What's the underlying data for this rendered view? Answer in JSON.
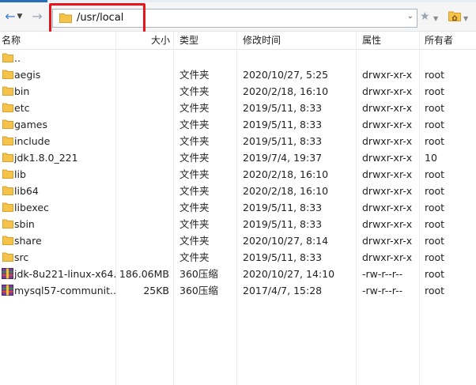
{
  "path": {
    "value": "/usr/local"
  },
  "columns": {
    "name": "名称",
    "size": "大小",
    "type": "类型",
    "modified": "修改时间",
    "attr": "属性",
    "owner": "所有者"
  },
  "rows": [
    {
      "name": "..",
      "size": "",
      "type": "",
      "modified": "",
      "attr": "",
      "owner": "",
      "icon": "folder-icon"
    },
    {
      "name": "aegis",
      "size": "",
      "type": "文件夹",
      "modified": "2020/10/27, 5:25",
      "attr": "drwxr-xr-x",
      "owner": "root",
      "icon": "folder-icon"
    },
    {
      "name": "bin",
      "size": "",
      "type": "文件夹",
      "modified": "2020/2/18, 16:10",
      "attr": "drwxr-xr-x",
      "owner": "root",
      "icon": "folder-icon"
    },
    {
      "name": "etc",
      "size": "",
      "type": "文件夹",
      "modified": "2019/5/11, 8:33",
      "attr": "drwxr-xr-x",
      "owner": "root",
      "icon": "folder-icon"
    },
    {
      "name": "games",
      "size": "",
      "type": "文件夹",
      "modified": "2019/5/11, 8:33",
      "attr": "drwxr-xr-x",
      "owner": "root",
      "icon": "folder-icon"
    },
    {
      "name": "include",
      "size": "",
      "type": "文件夹",
      "modified": "2019/5/11, 8:33",
      "attr": "drwxr-xr-x",
      "owner": "root",
      "icon": "folder-icon"
    },
    {
      "name": "jdk1.8.0_221",
      "size": "",
      "type": "文件夹",
      "modified": "2019/7/4, 19:37",
      "attr": "drwxr-xr-x",
      "owner": "10",
      "icon": "folder-icon"
    },
    {
      "name": "lib",
      "size": "",
      "type": "文件夹",
      "modified": "2020/2/18, 16:10",
      "attr": "drwxr-xr-x",
      "owner": "root",
      "icon": "folder-icon"
    },
    {
      "name": "lib64",
      "size": "",
      "type": "文件夹",
      "modified": "2020/2/18, 16:10",
      "attr": "drwxr-xr-x",
      "owner": "root",
      "icon": "folder-icon"
    },
    {
      "name": "libexec",
      "size": "",
      "type": "文件夹",
      "modified": "2019/5/11, 8:33",
      "attr": "drwxr-xr-x",
      "owner": "root",
      "icon": "folder-icon"
    },
    {
      "name": "sbin",
      "size": "",
      "type": "文件夹",
      "modified": "2019/5/11, 8:33",
      "attr": "drwxr-xr-x",
      "owner": "root",
      "icon": "folder-icon"
    },
    {
      "name": "share",
      "size": "",
      "type": "文件夹",
      "modified": "2020/10/27, 8:14",
      "attr": "drwxr-xr-x",
      "owner": "root",
      "icon": "folder-icon"
    },
    {
      "name": "src",
      "size": "",
      "type": "文件夹",
      "modified": "2019/5/11, 8:33",
      "attr": "drwxr-xr-x",
      "owner": "root",
      "icon": "folder-icon"
    },
    {
      "name": "jdk-8u221-linux-x64...",
      "size": "186.06MB",
      "type": "360压缩",
      "modified": "2020/10/27, 14:10",
      "attr": "-rw-r--r--",
      "owner": "root",
      "icon": "archive-icon"
    },
    {
      "name": "mysql57-communit...",
      "size": "25KB",
      "type": "360压缩",
      "modified": "2017/4/7, 15:28",
      "attr": "-rw-r--r--",
      "owner": "root",
      "icon": "archive-icon"
    }
  ],
  "colors": {
    "folder": "#f5c24a",
    "highlight": "#e8141b",
    "accent": "#3b7fd4"
  }
}
